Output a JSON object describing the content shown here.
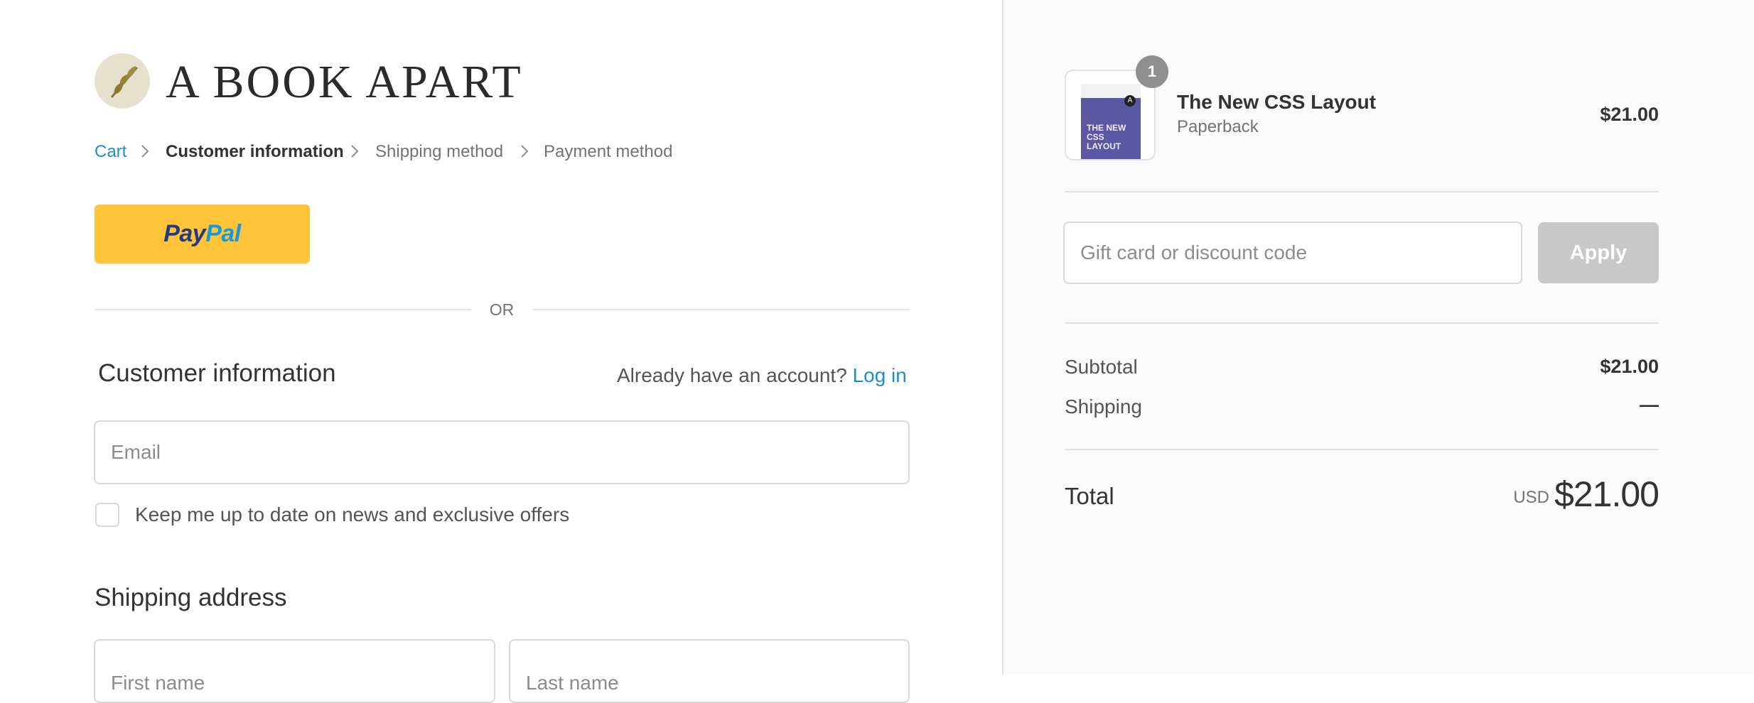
{
  "brand": {
    "name": "A BOOK APART"
  },
  "breadcrumb": {
    "items": [
      {
        "label": "Cart"
      },
      {
        "label": "Customer information"
      },
      {
        "label": "Shipping method"
      },
      {
        "label": "Payment method"
      }
    ]
  },
  "express": {
    "paypal_pay": "Pay",
    "paypal_pal": "Pal",
    "divider": "OR"
  },
  "customer": {
    "heading": "Customer information",
    "account_prompt": "Already have an account?",
    "login_label": "Log in",
    "email_placeholder": "Email",
    "newsletter_label": "Keep me up to date on news and exclusive offers"
  },
  "shipping": {
    "heading": "Shipping address",
    "first_name_placeholder": "First name",
    "last_name_placeholder": "Last name"
  },
  "summary": {
    "item": {
      "quantity": "1",
      "name": "The New CSS Layout",
      "variant": "Paperback",
      "price": "$21.00",
      "cover_title_line1": "THE NEW",
      "cover_title_line2": "CSS LAYOUT"
    },
    "discount_placeholder": "Gift card or discount code",
    "apply_label": "Apply",
    "subtotal_label": "Subtotal",
    "subtotal_value": "$21.00",
    "shipping_label": "Shipping",
    "shipping_value": "—",
    "total_label": "Total",
    "currency": "USD",
    "total_value": "$21.00"
  },
  "colors": {
    "link": "#1990c6",
    "paypal_button": "#ffc439",
    "paypal_dark": "#253b80",
    "paypal_light": "#179bd7",
    "apply_disabled": "#c8c8c8",
    "sidebar_bg": "#fafafa",
    "book_cover": "#5b57a3"
  },
  "icons": [
    "leaf-logo-icon",
    "chevron-right-icon"
  ]
}
